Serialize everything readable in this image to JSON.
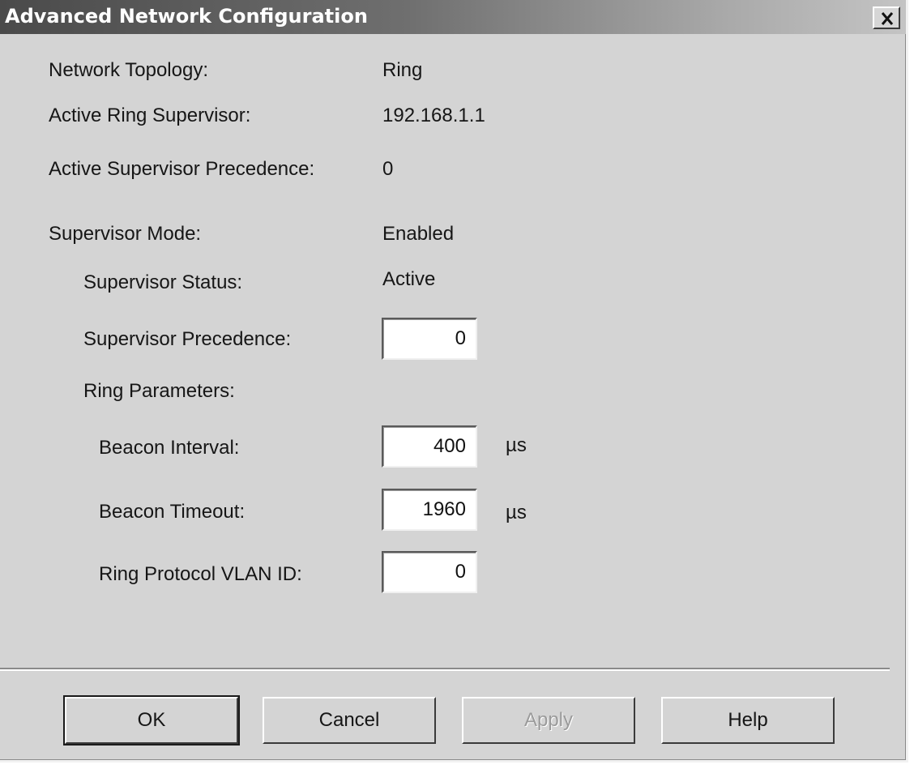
{
  "window": {
    "title": "Advanced Network Configuration",
    "close_symbol": "×",
    "close_icon": "close-x-icon"
  },
  "info": {
    "network_topology_label": "Network Topology:",
    "network_topology_value": "Ring",
    "active_ring_supervisor_label": "Active Ring Supervisor:",
    "active_ring_supervisor_value": "192.168.1.1",
    "active_supervisor_precedence_label": "Active Supervisor Precedence:",
    "active_supervisor_precedence_value": "0",
    "supervisor_mode_label": "Supervisor Mode:",
    "supervisor_mode_value": "Enabled",
    "supervisor_status_label": "Supervisor Status:",
    "supervisor_status_value": "Active"
  },
  "form": {
    "supervisor_precedence_label": "Supervisor Precedence:",
    "supervisor_precedence_value": "0",
    "ring_parameters_label": "Ring Parameters:",
    "beacon_interval_label": "Beacon Interval:",
    "beacon_interval_value": "400",
    "beacon_interval_unit": "µs",
    "beacon_timeout_label": "Beacon Timeout:",
    "beacon_timeout_value": "1960",
    "beacon_timeout_unit": "µs",
    "ring_protocol_vlan_label": "Ring Protocol VLAN ID:",
    "ring_protocol_vlan_value": "0"
  },
  "buttons": {
    "ok": "OK",
    "cancel": "Cancel",
    "apply": "Apply",
    "help": "Help"
  }
}
